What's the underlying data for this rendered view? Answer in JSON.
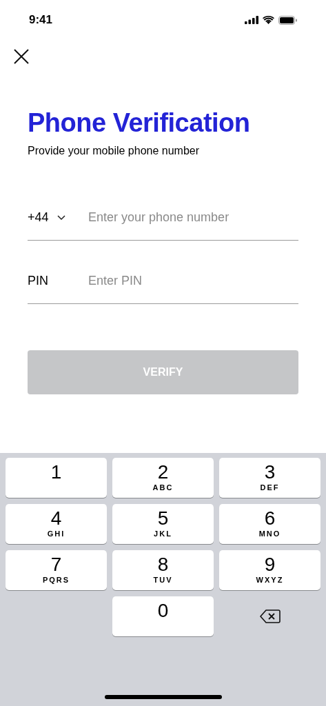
{
  "status_bar": {
    "time": "9:41"
  },
  "title": "Phone Verification",
  "subtitle": "Provide your mobile phone number",
  "phone": {
    "country_code": "+44",
    "placeholder": "Enter your phone number"
  },
  "pin": {
    "label": "PIN",
    "placeholder": "Enter PIN"
  },
  "button": {
    "label": "VERIFY",
    "disabled": true
  },
  "keypad": [
    {
      "kind": "digit",
      "digit": "1"
    },
    {
      "kind": "digit",
      "digit": "2",
      "letters": "ABC"
    },
    {
      "kind": "digit",
      "digit": "3",
      "letters": "DEF"
    },
    {
      "kind": "digit",
      "digit": "4",
      "letters": "GHI"
    },
    {
      "kind": "digit",
      "digit": "5",
      "letters": "JKL"
    },
    {
      "kind": "digit",
      "digit": "6",
      "letters": "MNO"
    },
    {
      "kind": "digit",
      "digit": "7",
      "letters": "PQRS"
    },
    {
      "kind": "digit",
      "digit": "8",
      "letters": "TUV"
    },
    {
      "kind": "digit",
      "digit": "9",
      "letters": "WXYZ"
    },
    {
      "kind": "blank"
    },
    {
      "kind": "digit",
      "digit": "0"
    },
    {
      "kind": "delete"
    }
  ]
}
